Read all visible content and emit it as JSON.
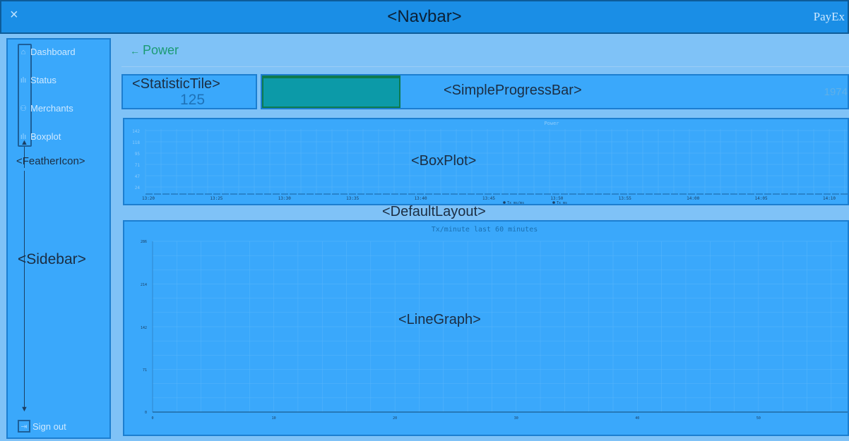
{
  "navbar": {
    "title": "<Navbar>",
    "close_icon": "×",
    "brand": "PayEx"
  },
  "sidebar": {
    "label": "<Sidebar>",
    "feather_label": "<FeatherIcon>",
    "items": [
      {
        "label": "Dashboard",
        "icon": "home-icon",
        "glyph": "⌂"
      },
      {
        "label": "Status",
        "icon": "bar-chart-icon",
        "glyph": "ılı"
      },
      {
        "label": "Merchants",
        "icon": "users-icon",
        "glyph": "⚇"
      },
      {
        "label": "Boxplot",
        "icon": "bar-chart-icon",
        "glyph": "ılı"
      }
    ],
    "signout": {
      "label": "Sign out",
      "icon": "log-out-icon",
      "glyph": "⇥"
    }
  },
  "page": {
    "title": "Power",
    "back_glyph": "←"
  },
  "layout_label": "<DefaultLayout>",
  "statistic_tile": {
    "label": "<StatisticTile>",
    "value": "125"
  },
  "progress": {
    "label": "<SimpleProgressBar>",
    "value": 125,
    "total": "1974",
    "fraction": 0.236
  },
  "boxplot": {
    "label": "<BoxPlot>"
  },
  "linegraph": {
    "label": "<LineGraph>"
  },
  "chart_data": [
    {
      "type": "box",
      "title": "Power",
      "y_ticks": [
        "142",
        "118",
        "95",
        "71",
        "47",
        "24"
      ],
      "x_ticks": [
        "13:20",
        "13:25",
        "13:30",
        "13:35",
        "13:40",
        "13:45",
        "13:50",
        "13:55",
        "14:00",
        "14:05",
        "14:10"
      ],
      "legend": [
        "Tx ms/ms",
        "Tx ms"
      ],
      "ylim": [
        0,
        142
      ]
    },
    {
      "type": "line",
      "title": "Tx/minute last 60 minutes",
      "y_ticks": [
        "286",
        "214",
        "142",
        "71",
        "0"
      ],
      "x_ticks": [
        "0",
        "10",
        "20",
        "30",
        "40",
        "50"
      ],
      "ylim": [
        0,
        286
      ],
      "xlim": [
        0,
        57
      ]
    }
  ]
}
